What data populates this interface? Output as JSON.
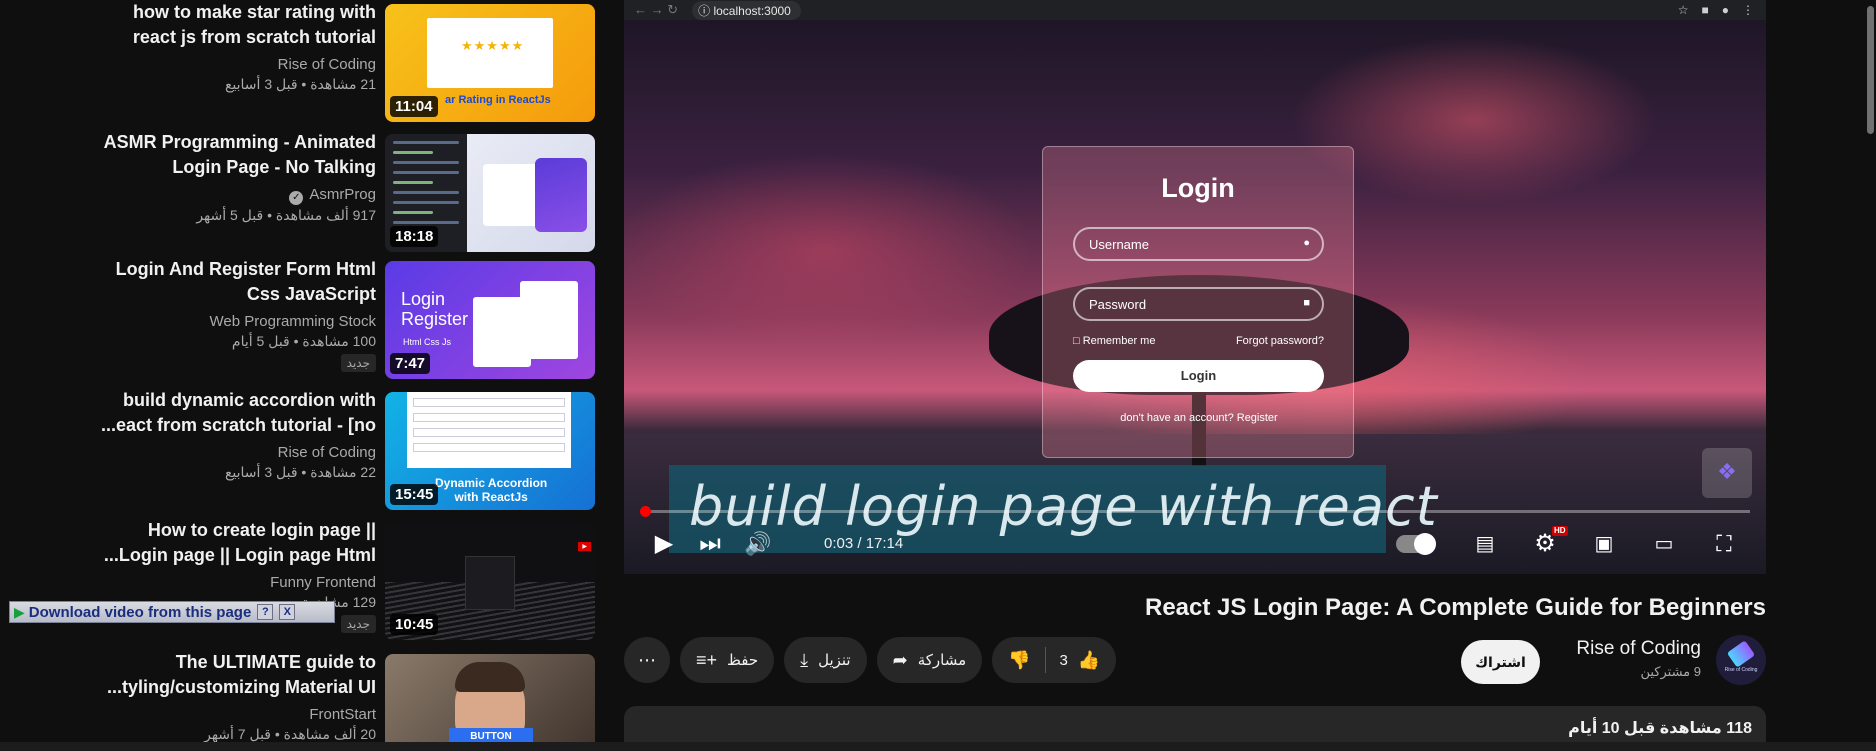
{
  "browser": {
    "url": "localhost:3000"
  },
  "sidebar": {
    "items": [
      {
        "title_line1": "how to make star rating with",
        "title_line2": "react js from scratch tutorial",
        "channel": "Rise of Coding",
        "stats": "21 مشاهدة • قبل 3 أسابيع",
        "duration": "11:04",
        "thumb_caption": "ar Rating in ReactJs",
        "thumb_stars": "★★★★★",
        "badge": ""
      },
      {
        "title_line1": "ASMR Programming - Animated",
        "title_line2": "Login Page - No Talking",
        "channel": "AsmrProg",
        "verified_icon": "✓",
        "stats": "917 ألف مشاهدة • قبل 5 أشهر",
        "duration": "18:18",
        "badge": ""
      },
      {
        "title_line1": "Login And Register Form Html",
        "title_line2": "Css JavaScript",
        "channel": "Web Programming Stock",
        "stats": "100 مشاهدة • قبل 5 أيام",
        "duration": "7:47",
        "thumb_big_line1": "Login",
        "thumb_big_line2": "Register",
        "thumb_small": "Html Css Js",
        "badge": "جديد"
      },
      {
        "title_line1": "build dynamic accordion with",
        "title_line2": "...eact from scratch tutorial - [no",
        "channel": "Rise of Coding",
        "stats": "22 مشاهدة • قبل 3 أسابيع",
        "duration": "15:45",
        "thumb_caption_line1": "Dynamic Accordion",
        "thumb_caption_line2": "with ReactJs",
        "badge": ""
      },
      {
        "title_line1": "How to create login page ||",
        "title_line2": "...Login page || Login page Html",
        "channel": "Funny Frontend",
        "stats": "129 مشاهدة",
        "duration": "10:45",
        "badge": "جديد"
      },
      {
        "title_line1": "The ULTIMATE guide to",
        "title_line2": "...tyling/customizing Material UI",
        "channel": "FrontStart",
        "stats": "20 ألف مشاهدة • قبل 7 أشهر",
        "duration": "",
        "thumb_button": "BUTTON",
        "badge": ""
      }
    ]
  },
  "download_bar": {
    "label": "Download video from this page",
    "help": "?",
    "close": "X"
  },
  "player": {
    "login_title": "Login",
    "username_placeholder": "Username",
    "password_placeholder": "Password",
    "remember": "Remember me",
    "forgot": "Forgot password?",
    "login_button": "Login",
    "register_text": "don't have an account? Register",
    "caption": "build login page with react",
    "time": "0:03 / 17:14",
    "progress_fraction": 0.003,
    "hd_badge": "HD"
  },
  "video": {
    "title": "React JS Login Page: A Complete Guide for Beginners",
    "channel": "Rise of Coding",
    "subscribers": "9 مشتركين",
    "subscribe_label": "اشتراك",
    "likes": "3",
    "share_label": "مشاركة",
    "download_label": "تنزيل",
    "save_label": "حفظ",
    "views_date": "118 مشاهدة قبل 10 أيام"
  }
}
